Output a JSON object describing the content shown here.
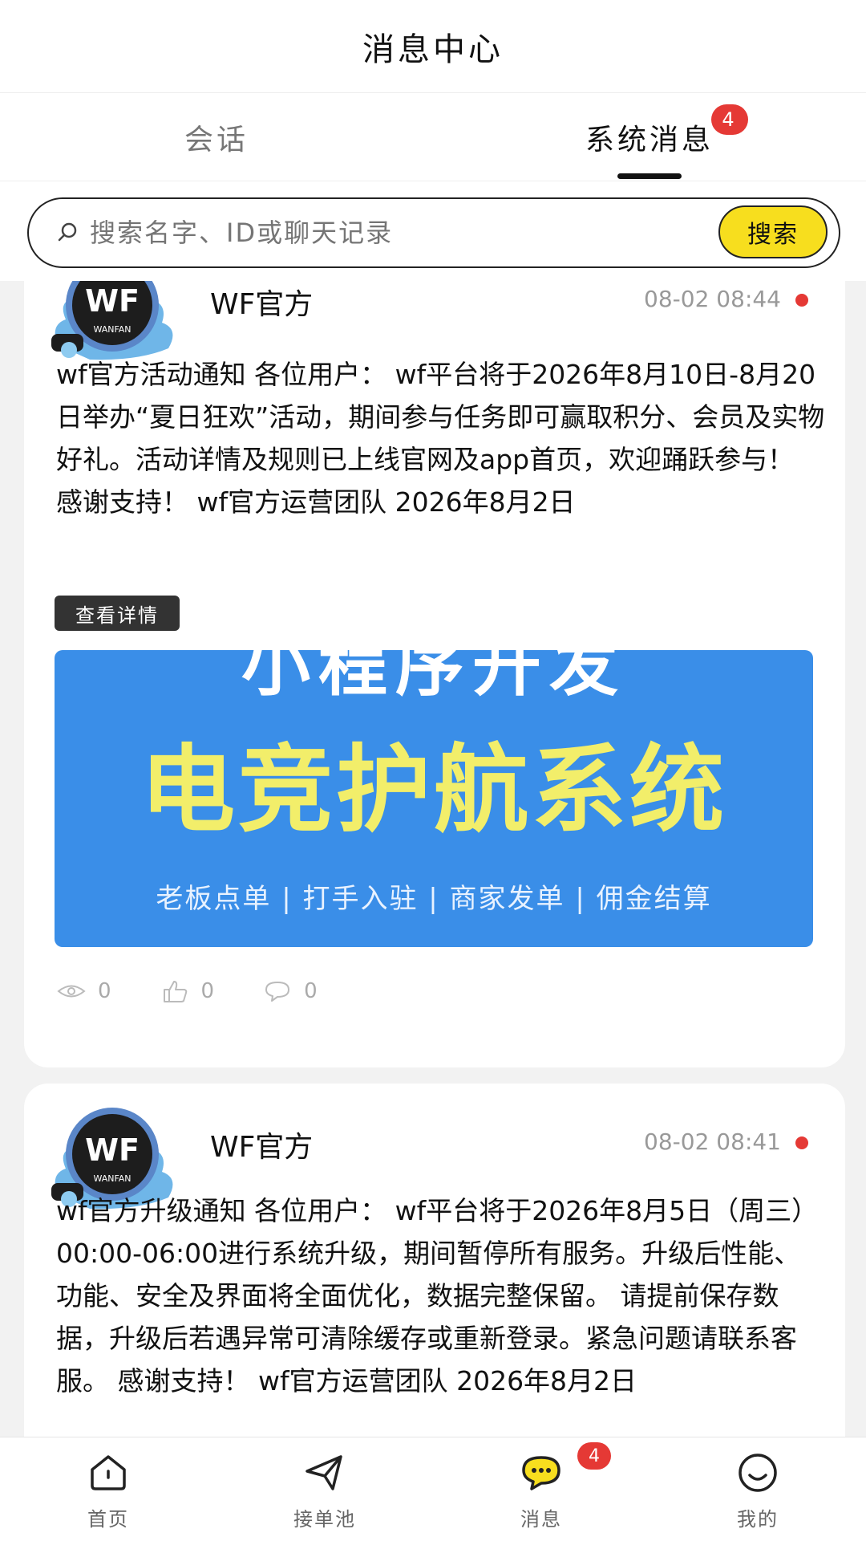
{
  "header": {
    "title": "消息中心"
  },
  "tabs": [
    {
      "label": "会话",
      "active": false
    },
    {
      "label": "系统消息",
      "active": true,
      "badge": "4"
    }
  ],
  "search": {
    "placeholder": "搜索名字、ID或聊天记录",
    "button_label": "搜索"
  },
  "messages": [
    {
      "sender": "WF官方",
      "avatar_text": "WF",
      "avatar_sub": "WANFAN",
      "time": "08-02 08:44",
      "unread": true,
      "body": "wf官方活动通知 各位用户： wf平台将于2026年8月10日-8月20日举办“夏日狂欢”活动，期间参与任务即可赢取积分、会员及实物好礼。活动详情及规则已上线官网及app首页，欢迎踊跃参与！ 感谢支持！ wf官方运营团队 2026年8月2日",
      "detail_button": "查看详情",
      "banner": {
        "top_text": "小程序开发",
        "main_text": "电竞护航系统",
        "sub_text": "老板点单 | 打手入驻 | 商家发单 | 佣金结算"
      },
      "stats": {
        "views": "0",
        "likes": "0",
        "comments": "0"
      }
    },
    {
      "sender": "WF官方",
      "avatar_text": "WF",
      "avatar_sub": "WANFAN",
      "time": "08-02 08:41",
      "unread": true,
      "body": "wf官方升级通知 各位用户： wf平台将于2026年8月5日（周三）00:00-06:00进行系统升级，期间暂停所有服务。升级后性能、功能、安全及界面将全面优化，数据完整保留。 请提前保存数据，升级后若遇异常可清除缓存或重新登录。紧急问题请联系客服。 感谢支持！ wf官方运营团队 2026年8月2日"
    }
  ],
  "bottom_nav": [
    {
      "label": "首页",
      "icon": "home-icon"
    },
    {
      "label": "接单池",
      "icon": "send-icon"
    },
    {
      "label": "消息",
      "icon": "chat-icon",
      "badge": "4",
      "active": true
    },
    {
      "label": "我的",
      "icon": "smile-icon"
    }
  ],
  "colors": {
    "accent": "#f7de1e",
    "badge": "#e53935",
    "banner": "#3a8ee8"
  }
}
